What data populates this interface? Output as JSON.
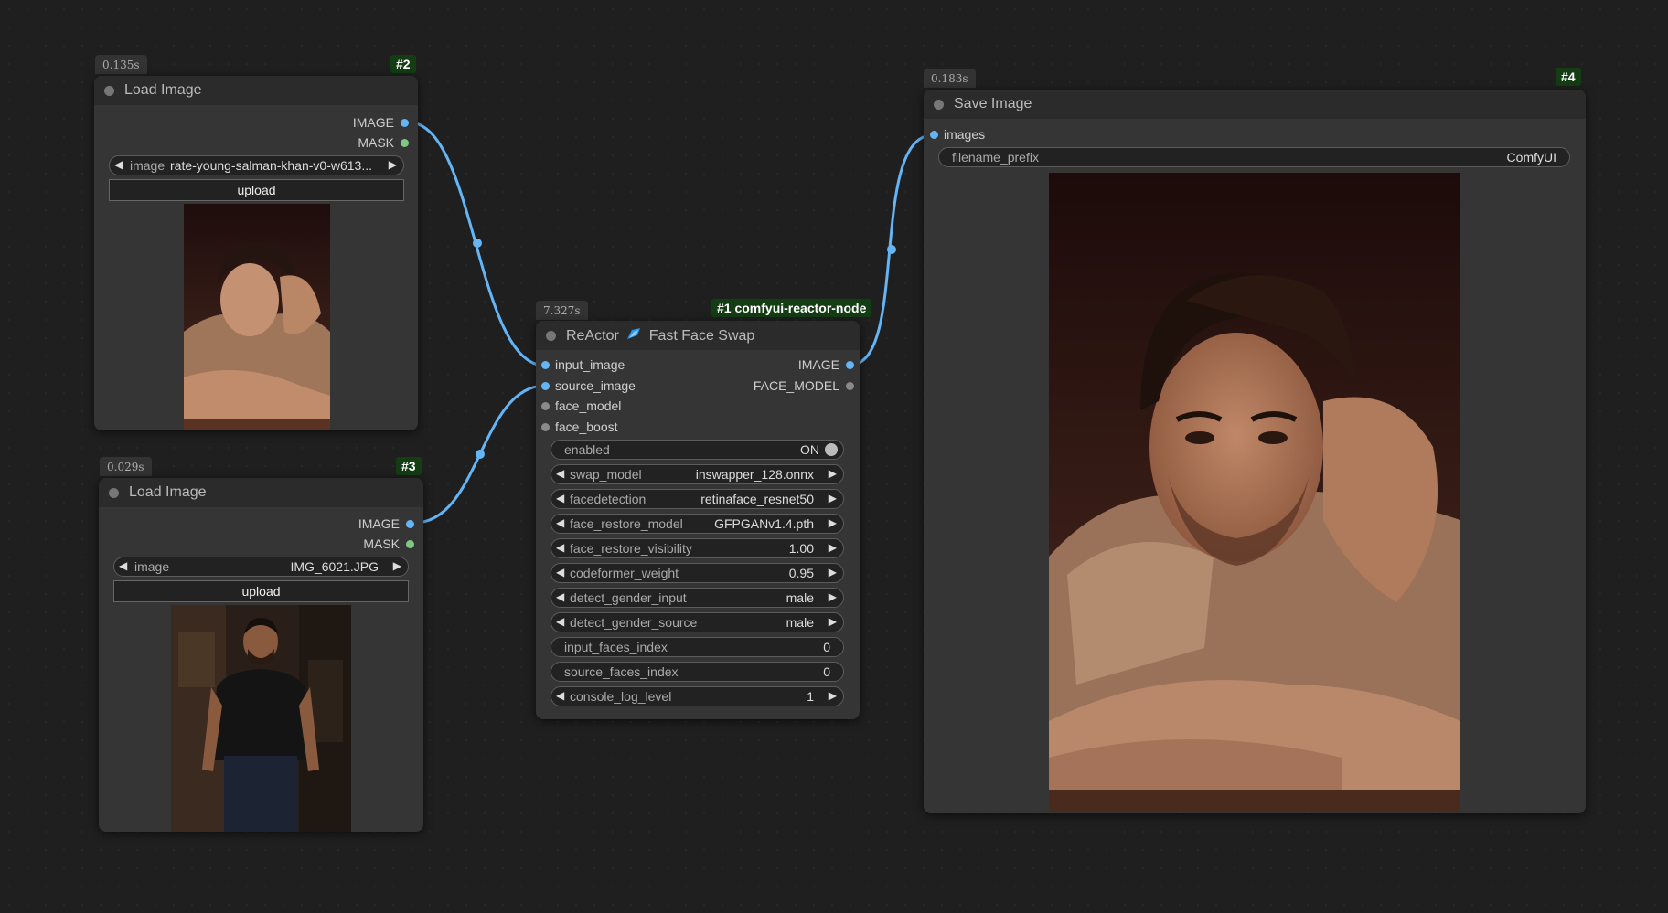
{
  "nodes": {
    "load1": {
      "timing": "0.135s",
      "id": "#2",
      "title": "Load Image",
      "outputs": [
        "IMAGE",
        "MASK"
      ],
      "image_widget": {
        "name": "image",
        "value": "rate-young-salman-khan-v0-w613..."
      },
      "upload_label": "upload"
    },
    "load2": {
      "timing": "0.029s",
      "id": "#3",
      "title": "Load Image",
      "outputs": [
        "IMAGE",
        "MASK"
      ],
      "image_widget": {
        "name": "image",
        "value": "IMG_6021.JPG"
      },
      "upload_label": "upload"
    },
    "reactor": {
      "timing": "7.327s",
      "id": "#1 comfyui-reactor-node",
      "title_prefix": "ReActor",
      "title_suffix": "Fast Face Swap",
      "inputs": [
        "input_image",
        "source_image",
        "face_model",
        "face_boost"
      ],
      "outputs": [
        "IMAGE",
        "FACE_MODEL"
      ],
      "widgets": [
        {
          "name": "enabled",
          "value": "ON",
          "kind": "toggle"
        },
        {
          "name": "swap_model",
          "value": "inswapper_128.onnx",
          "kind": "combo"
        },
        {
          "name": "facedetection",
          "value": "retinaface_resnet50",
          "kind": "combo"
        },
        {
          "name": "face_restore_model",
          "value": "GFPGANv1.4.pth",
          "kind": "combo"
        },
        {
          "name": "face_restore_visibility",
          "value": "1.00",
          "kind": "combo"
        },
        {
          "name": "codeformer_weight",
          "value": "0.95",
          "kind": "combo"
        },
        {
          "name": "detect_gender_input",
          "value": "male",
          "kind": "combo"
        },
        {
          "name": "detect_gender_source",
          "value": "male",
          "kind": "combo"
        },
        {
          "name": "input_faces_index",
          "value": "0",
          "kind": "text"
        },
        {
          "name": "source_faces_index",
          "value": "0",
          "kind": "text"
        },
        {
          "name": "console_log_level",
          "value": "1",
          "kind": "combo"
        }
      ]
    },
    "save": {
      "timing": "0.183s",
      "id": "#4",
      "title": "Save Image",
      "inputs": [
        "images"
      ],
      "filename_prefix": {
        "name": "filename_prefix",
        "value": "ComfyUI"
      }
    }
  },
  "colors": {
    "image_slot": "#64b5f6",
    "mask_slot": "#81c784",
    "other_slot": "#8a8a8a",
    "wire": "#64b5f6",
    "id_badge_bg": "#143d14"
  },
  "icons": {
    "reactor_logo": "rocket-icon",
    "combo_left": "◀",
    "combo_right": "▶"
  }
}
